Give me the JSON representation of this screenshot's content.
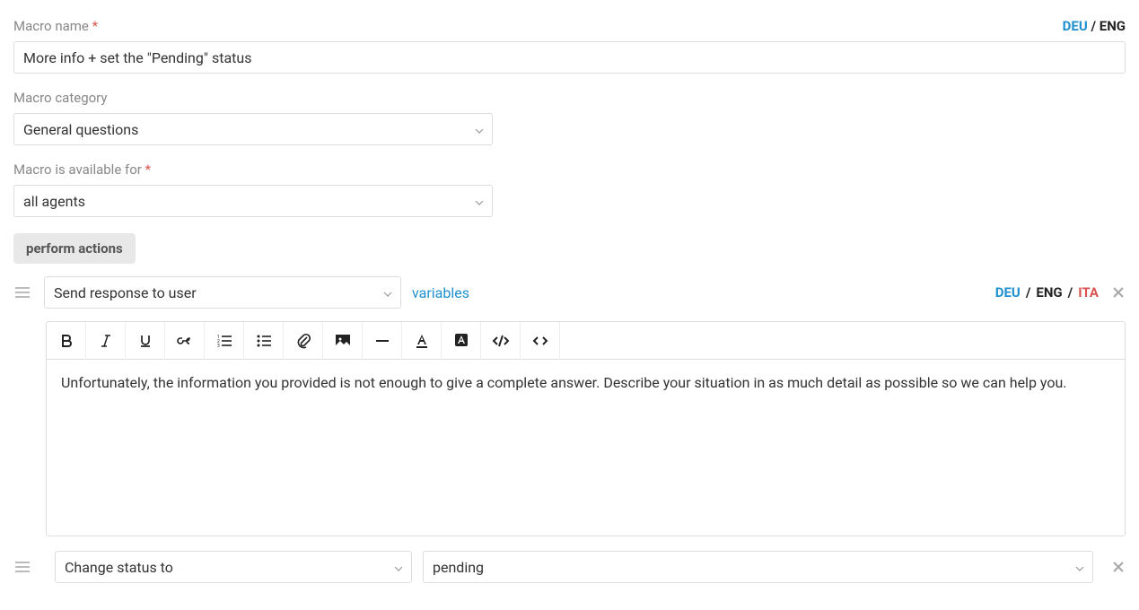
{
  "labels": {
    "macro_name": "Macro name",
    "macro_category": "Macro category",
    "macro_available": "Macro is available for"
  },
  "fields": {
    "macro_name_value": "More info + set the \"Pending\" status",
    "macro_category_value": "General questions",
    "macro_available_value": "all agents"
  },
  "tab": {
    "perform_actions": "perform actions"
  },
  "languages": {
    "deu": "DEU",
    "eng": "ENG",
    "ita": "ITA"
  },
  "actions": {
    "a1": {
      "type": "Send response to user",
      "variables_link": "variables",
      "content": "Unfortunately, the information you provided is not enough to give a complete answer. Describe your situation in as much detail as possible so we can help you."
    },
    "a2": {
      "type": "Change status to",
      "value": "pending"
    }
  }
}
